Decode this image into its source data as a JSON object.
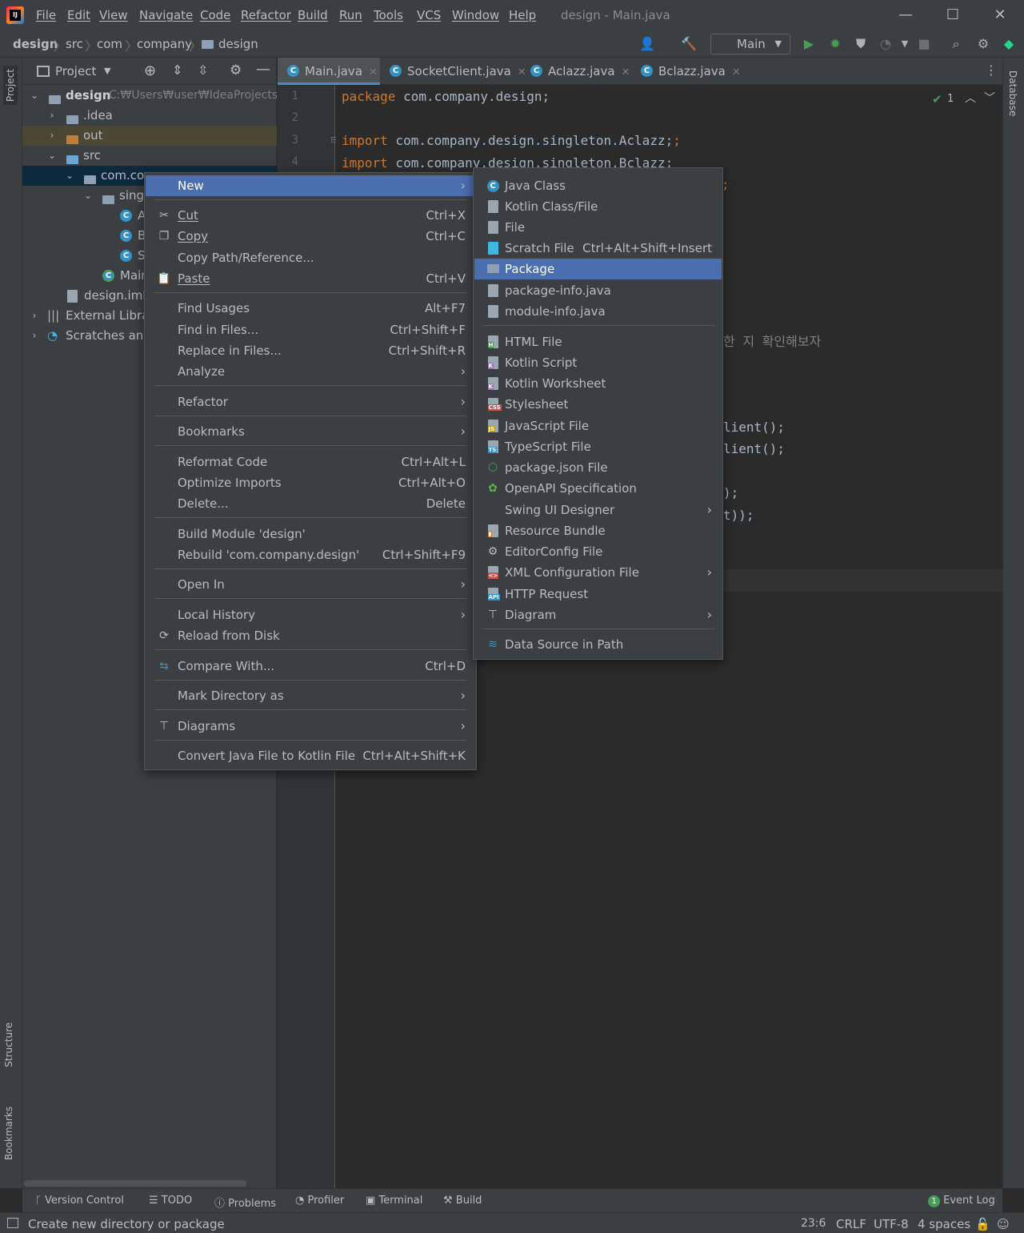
{
  "window": {
    "title": "design - Main.java",
    "menu": [
      "File",
      "Edit",
      "View",
      "Navigate",
      "Code",
      "Refactor",
      "Build",
      "Run",
      "Tools",
      "VCS",
      "Window",
      "Help"
    ],
    "controls": {
      "minimize": "—",
      "maximize": "☐",
      "close": "✕"
    }
  },
  "breadcrumb": [
    "design",
    "src",
    "com",
    "company",
    "design"
  ],
  "toolbar": {
    "run_config": "Main"
  },
  "left_stripe": {
    "project": "Project",
    "structure": "Structure",
    "bookmarks": "Bookmarks"
  },
  "right_stripe": {
    "database": "Database"
  },
  "project_panel": {
    "title": "Project",
    "tree": [
      {
        "label": "design",
        "hint": "C:₩Users₩user₩IdeaProjects₩d"
      },
      {
        "label": ".idea"
      },
      {
        "label": "out"
      },
      {
        "label": "src"
      },
      {
        "label": "com.cor"
      },
      {
        "label": "singl"
      },
      {
        "label": "A"
      },
      {
        "label": "B"
      },
      {
        "label": "S"
      },
      {
        "label": "Main"
      },
      {
        "label": "design.iml"
      },
      {
        "label": "External Librar"
      },
      {
        "label": "Scratches and"
      }
    ]
  },
  "editor": {
    "tabs": [
      "Main.java",
      "SocketClient.java",
      "Aclazz.java",
      "Bclazz.java"
    ],
    "active_tab": "Main.java",
    "inspection_count": "1",
    "line_numbers": [
      "1",
      "2",
      "3",
      "4"
    ],
    "lines": [
      {
        "kw": "package",
        "rest": " com.company.design;"
      },
      {
        "kw": "",
        "rest": ""
      },
      {
        "kw": "import",
        "rest": " com.company.design.singleton.Aclazz;"
      },
      {
        "kw": "import",
        "rest": " com.company.design.singleton.Bclazz;"
      }
    ],
    "fragments": {
      "f1": ";",
      "f2": "한 지 확인해보자",
      "f3": "lient();",
      "f4": "lient();",
      "f5": ");",
      "f6": "t));"
    }
  },
  "context_menu": {
    "items": [
      {
        "label": "New",
        "submenu": true
      },
      {
        "label": "Cut",
        "shortcut": "Ctrl+X"
      },
      {
        "label": "Copy",
        "shortcut": "Ctrl+C"
      },
      {
        "label": "Copy Path/Reference..."
      },
      {
        "label": "Paste",
        "shortcut": "Ctrl+V"
      },
      {
        "label": "Find Usages",
        "shortcut": "Alt+F7"
      },
      {
        "label": "Find in Files...",
        "shortcut": "Ctrl+Shift+F"
      },
      {
        "label": "Replace in Files...",
        "shortcut": "Ctrl+Shift+R"
      },
      {
        "label": "Analyze",
        "submenu": true
      },
      {
        "label": "Refactor",
        "submenu": true
      },
      {
        "label": "Bookmarks",
        "submenu": true
      },
      {
        "label": "Reformat Code",
        "shortcut": "Ctrl+Alt+L"
      },
      {
        "label": "Optimize Imports",
        "shortcut": "Ctrl+Alt+O"
      },
      {
        "label": "Delete...",
        "shortcut": "Delete"
      },
      {
        "label": "Build Module 'design'"
      },
      {
        "label": "Rebuild 'com.company.design'",
        "shortcut": "Ctrl+Shift+F9"
      },
      {
        "label": "Open In",
        "submenu": true
      },
      {
        "label": "Local History",
        "submenu": true
      },
      {
        "label": "Reload from Disk"
      },
      {
        "label": "Compare With...",
        "shortcut": "Ctrl+D"
      },
      {
        "label": "Mark Directory as",
        "submenu": true
      },
      {
        "label": "Diagrams",
        "submenu": true
      },
      {
        "label": "Convert Java File to Kotlin File",
        "shortcut": "Ctrl+Alt+Shift+K"
      }
    ]
  },
  "new_submenu": {
    "items": [
      {
        "label": "Java Class",
        "icon": "java-class-icon"
      },
      {
        "label": "Kotlin Class/File",
        "icon": "kotlin-file-icon"
      },
      {
        "label": "File",
        "icon": "file-icon"
      },
      {
        "label": "Scratch File",
        "shortcut": "Ctrl+Alt+Shift+Insert",
        "icon": "scratch-file-icon"
      },
      {
        "label": "Package",
        "icon": "package-icon"
      },
      {
        "label": "package-info.java",
        "icon": "java-file-icon"
      },
      {
        "label": "module-info.java",
        "icon": "java-file-icon"
      },
      {
        "label": "HTML File",
        "icon": "html-file-icon"
      },
      {
        "label": "Kotlin Script",
        "icon": "kotlin-script-icon"
      },
      {
        "label": "Kotlin Worksheet",
        "icon": "kotlin-worksheet-icon"
      },
      {
        "label": "Stylesheet",
        "icon": "css-file-icon"
      },
      {
        "label": "JavaScript File",
        "icon": "js-file-icon"
      },
      {
        "label": "TypeScript File",
        "icon": "ts-file-icon"
      },
      {
        "label": "package.json File",
        "icon": "nodejs-icon"
      },
      {
        "label": "OpenAPI Specification",
        "icon": "openapi-icon"
      },
      {
        "label": "Swing UI Designer",
        "submenu": true
      },
      {
        "label": "Resource Bundle",
        "icon": "resource-bundle-icon"
      },
      {
        "label": "EditorConfig File",
        "icon": "gear-icon"
      },
      {
        "label": "XML Configuration File",
        "submenu": true,
        "icon": "xml-file-icon"
      },
      {
        "label": "HTTP Request",
        "icon": "api-file-icon"
      },
      {
        "label": "Diagram",
        "submenu": true,
        "icon": "diagram-icon"
      },
      {
        "label": "Data Source in Path",
        "icon": "database-icon"
      }
    ]
  },
  "bottom_tools": [
    "Version Control",
    "TODO",
    "Problems",
    "Profiler",
    "Terminal",
    "Build"
  ],
  "event_log": {
    "count": "1",
    "label": "Event Log"
  },
  "status": {
    "message": "Create new directory or package",
    "position": "23:6",
    "line_sep": "CRLF",
    "encoding": "UTF-8",
    "indent": "4 spaces"
  },
  "colors": {
    "accent": "#4b6eaf",
    "keyword": "#cc7832",
    "code": "#a9b7c6",
    "panel": "#3c3f41"
  }
}
